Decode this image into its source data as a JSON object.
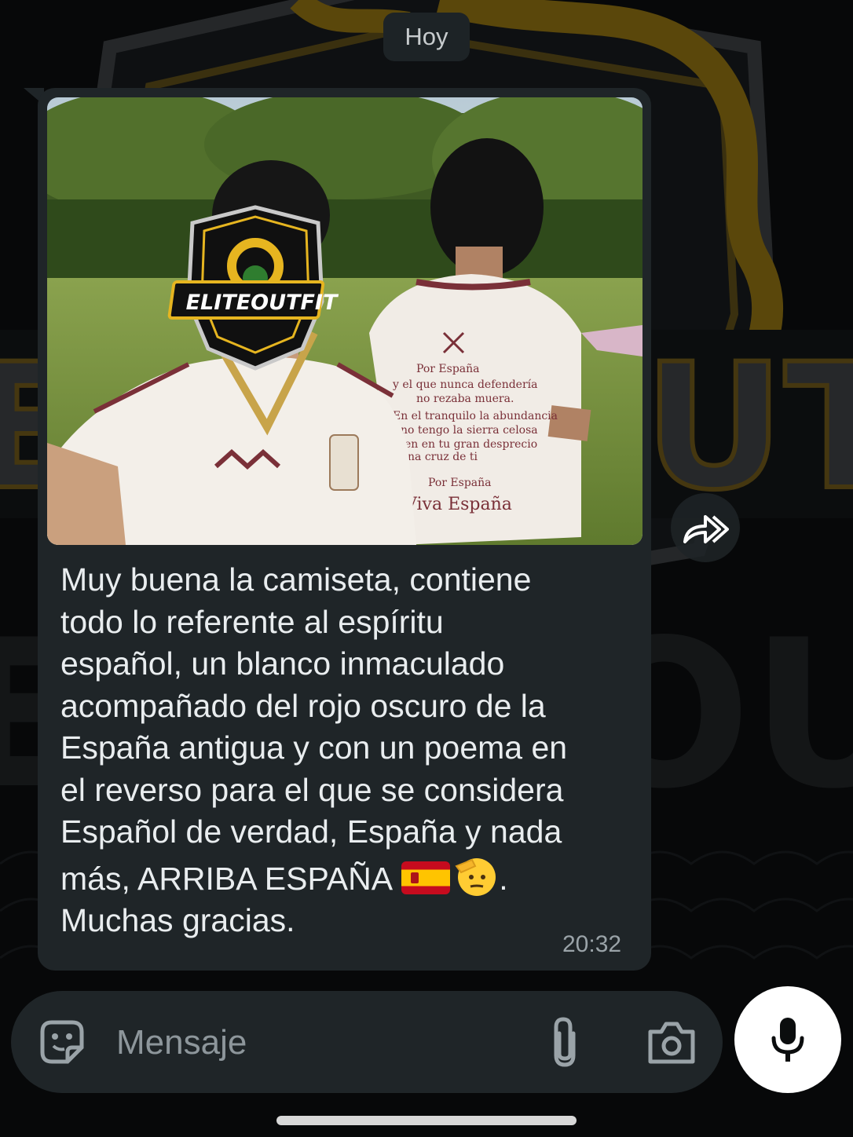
{
  "date_divider": "Hoy",
  "message": {
    "image_logo_text": "ELITEOUTFIT",
    "text_lines": [
      "Muy buena la camiseta, contiene",
      "todo lo referente al espíritu",
      "español, un blanco inmaculado",
      "acompañado del rojo oscuro de la",
      "España antigua y con un poema en",
      "el reverso para el que se considera",
      "Español de verdad, España y nada"
    ],
    "last_line_before_emoji": "más, ARRIBA ESPAÑA ",
    "emoji_flag": "spain-flag-emoji",
    "emoji_salute": "saluting-face-emoji",
    "last_line_after_emoji": ".",
    "closing_line": "Muchas gracias.",
    "time": "20:32"
  },
  "composer": {
    "placeholder": "Mensaje"
  },
  "colors": {
    "background": "#0b0d0e",
    "bubble": "#1f2528",
    "text": "#e9edef",
    "muted": "#9aa3a8",
    "mic_button": "#ffffff",
    "wallpaper_gold": "#c9a227"
  }
}
